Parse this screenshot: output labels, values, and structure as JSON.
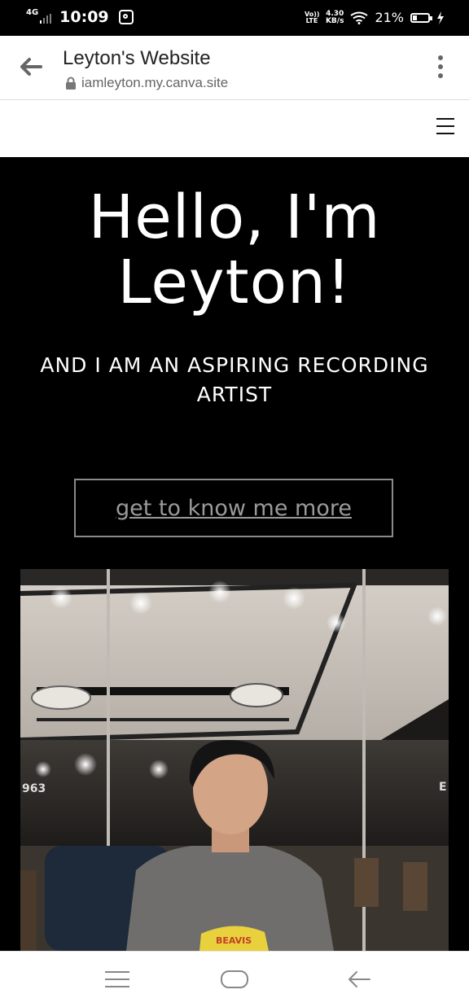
{
  "status_bar": {
    "network": "4G",
    "time": "10:09",
    "volte": "Vo)) LTE",
    "speed_value": "4.30",
    "speed_unit": "KB/s",
    "battery": "21%"
  },
  "browser": {
    "title": "Leyton's Website",
    "url": "iamleyton.my.canva.site"
  },
  "hero": {
    "title_line1": "Hello, I'm",
    "title_line2": "Leyton!",
    "subtitle": "AND I AM AN ASPIRING RECORDING ARTIST",
    "cta_label": "get to know me more"
  },
  "photo": {
    "sign_left": "963",
    "sign_right": "E",
    "shirt_text": "BEAVIS"
  },
  "colors": {
    "background": "#000000",
    "text": "#ffffff",
    "cta_border": "#8a8a8a"
  },
  "icons": [
    "back-arrow-icon",
    "lock-icon",
    "more-vert-icon",
    "hamburger-menu-icon",
    "recent-apps-icon",
    "home-icon",
    "back-icon"
  ]
}
